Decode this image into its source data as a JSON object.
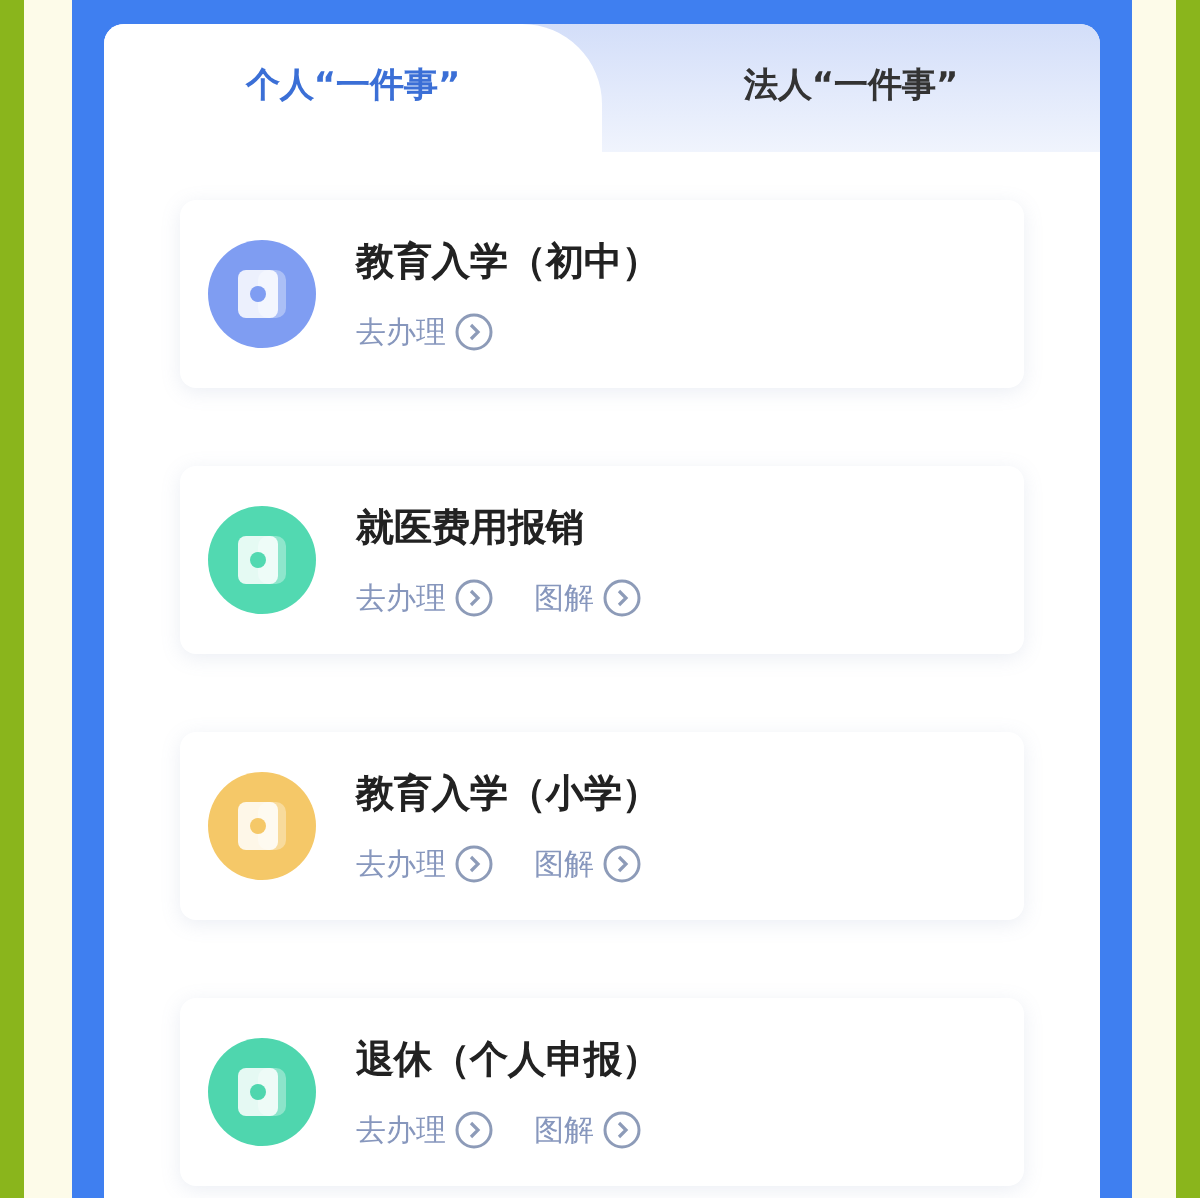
{
  "tabs": [
    {
      "label": "个人“一件事”",
      "selected": true
    },
    {
      "label": "法人“一件事”",
      "selected": false
    }
  ],
  "services": [
    {
      "title": "教育入学（初中）",
      "color": "#7f9df2",
      "actions": [
        "去办理"
      ]
    },
    {
      "title": "就医费用报销",
      "color": "#52d9b1",
      "actions": [
        "去办理",
        "图解"
      ]
    },
    {
      "title": "教育入学（小学）",
      "color": "#f5c868",
      "actions": [
        "去办理",
        "图解"
      ]
    },
    {
      "title": "退休（个人申报）",
      "color": "#4fd6ae",
      "actions": [
        "去办理",
        "图解"
      ]
    }
  ]
}
